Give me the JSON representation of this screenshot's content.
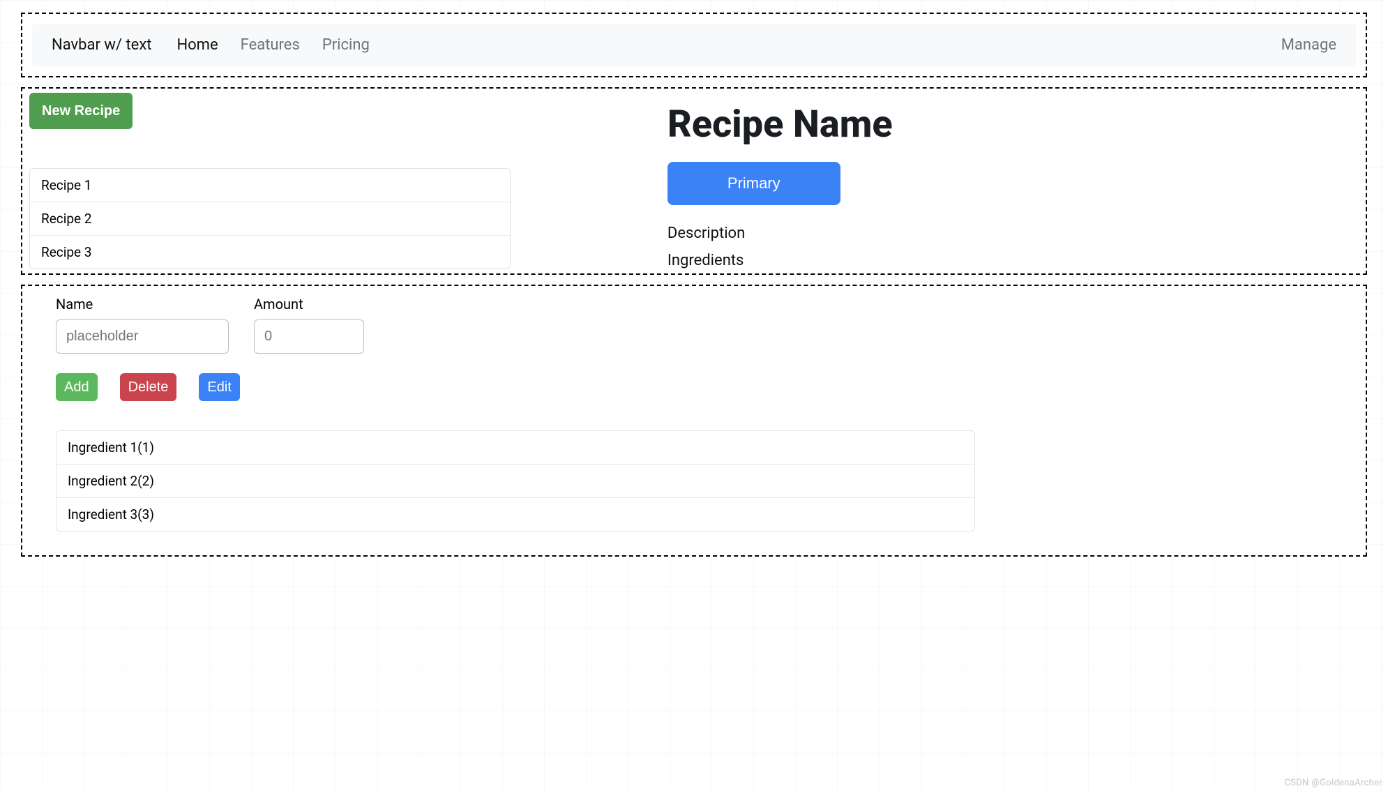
{
  "navbar": {
    "brand": "Navbar w/ text",
    "links": [
      "Home",
      "Features",
      "Pricing"
    ],
    "right_text": "Manage"
  },
  "recipe_panel": {
    "new_recipe_button": "New Recipe",
    "recipes": [
      "Recipe 1",
      "Recipe 2",
      "Recipe 3"
    ],
    "detail": {
      "title": "Recipe Name",
      "primary_button": "Primary",
      "description_label": "Description",
      "ingredients_label": "Ingredients"
    }
  },
  "ingredient_form": {
    "name_label": "Name",
    "name_placeholder": "placeholder",
    "amount_label": "Amount",
    "amount_placeholder": "0",
    "add_button": "Add",
    "delete_button": "Delete",
    "edit_button": "Edit",
    "ingredients": [
      "Ingredient 1(1)",
      "Ingredient 2(2)",
      "Ingredient 3(3)"
    ]
  },
  "watermark": "CSDN @GoldenaArcher"
}
